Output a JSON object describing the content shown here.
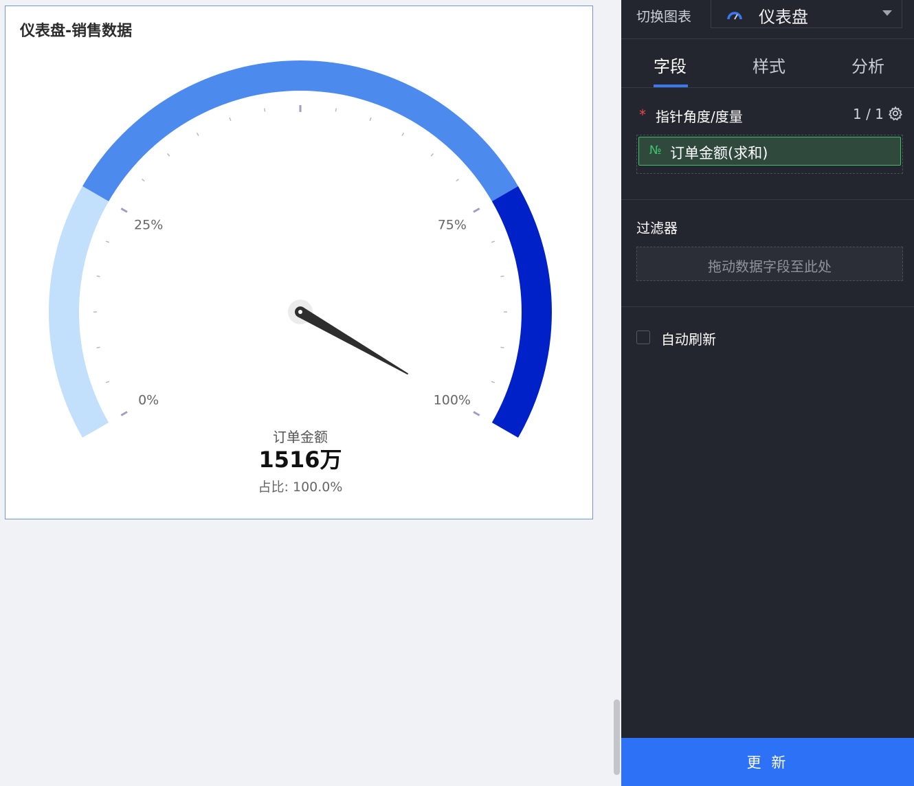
{
  "chart_card": {
    "title": "仪表盘-销售数据"
  },
  "chart_data": {
    "type": "gauge",
    "title": "仪表盘-销售数据",
    "measure_name": "订单金额",
    "value_text": "1516万",
    "ratio_text": "占比: 100.0%",
    "value_fraction": 1.0,
    "range": [
      0,
      100
    ],
    "tick_labels": [
      "0%",
      "25%",
      "75%",
      "100%"
    ],
    "bands": [
      {
        "from": 0,
        "to": 25,
        "color": "#c2dffc"
      },
      {
        "from": 25,
        "to": 75,
        "color": "#4c8aee"
      },
      {
        "from": 75,
        "to": 100,
        "color": "#0020c8"
      }
    ]
  },
  "panel": {
    "switch_label": "切换图表",
    "chart_type": "仪表盘",
    "tabs": [
      {
        "label": "字段",
        "active": true
      },
      {
        "label": "样式",
        "active": false
      },
      {
        "label": "分析",
        "active": false
      }
    ],
    "measure": {
      "required_mark": "*",
      "label": "指针角度/度量",
      "count": "1 / 1",
      "field_icon": "№",
      "field": "订单金额(求和)"
    },
    "filter": {
      "title": "过滤器",
      "placeholder": "拖动数据字段至此处"
    },
    "auto_refresh": {
      "label": "自动刷新",
      "checked": false
    },
    "update_button": "更 新"
  },
  "colors": {
    "accent": "#2d71f6",
    "field_green": "#3ec36b",
    "panel_bg": "#23262e",
    "needle": "#2e2e2e"
  }
}
